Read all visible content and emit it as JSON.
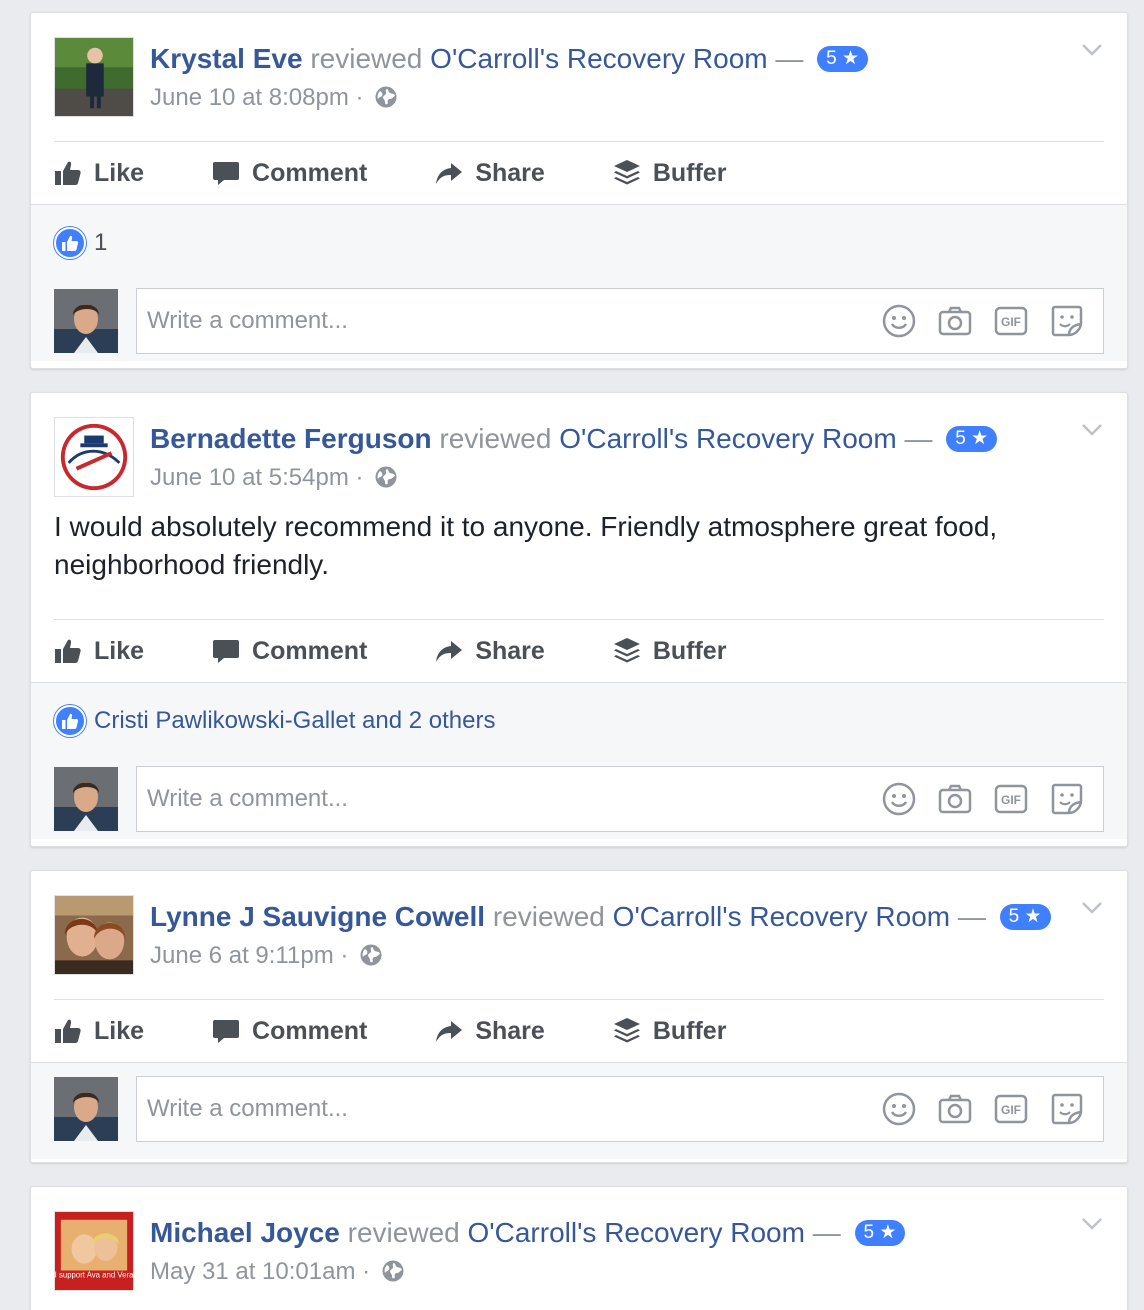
{
  "actions": {
    "like": "Like",
    "comment": "Comment",
    "share": "Share",
    "buffer": "Buffer"
  },
  "comment_placeholder": "Write a comment...",
  "reviewed_word": "reviewed",
  "dash": "—",
  "posts": [
    {
      "author": "Krystal Eve",
      "page": "O'Carroll's Recovery Room",
      "rating": "5 ★",
      "timestamp": "June 10 at 8:08pm ·",
      "text": "",
      "reactions": "1"
    },
    {
      "author": "Bernadette Ferguson",
      "page": "O'Carroll's Recovery Room",
      "rating": "5 ★",
      "timestamp": "June 10 at 5:54pm ·",
      "text": "I would absolutely recommend it to anyone. Friendly atmosphere great food, neighborhood friendly.",
      "reactions": "Cristi Pawlikowski-Gallet and 2 others"
    },
    {
      "author": "Lynne J Sauvigne Cowell",
      "page": "O'Carroll's Recovery Room",
      "rating": "5 ★",
      "timestamp": "June 6 at 9:11pm ·",
      "text": "",
      "reactions": ""
    },
    {
      "author": "Michael Joyce",
      "page": "O'Carroll's Recovery Room",
      "rating": "5 ★",
      "timestamp": "May 31 at 10:01am ·",
      "text": "",
      "reactions": ""
    }
  ],
  "avatar_texts": {
    "michael": "I support Ava and Vera"
  },
  "colors": {
    "link": "#365899",
    "muted": "#90949c",
    "badge": "#4080ff",
    "background": "#e9ebee"
  }
}
